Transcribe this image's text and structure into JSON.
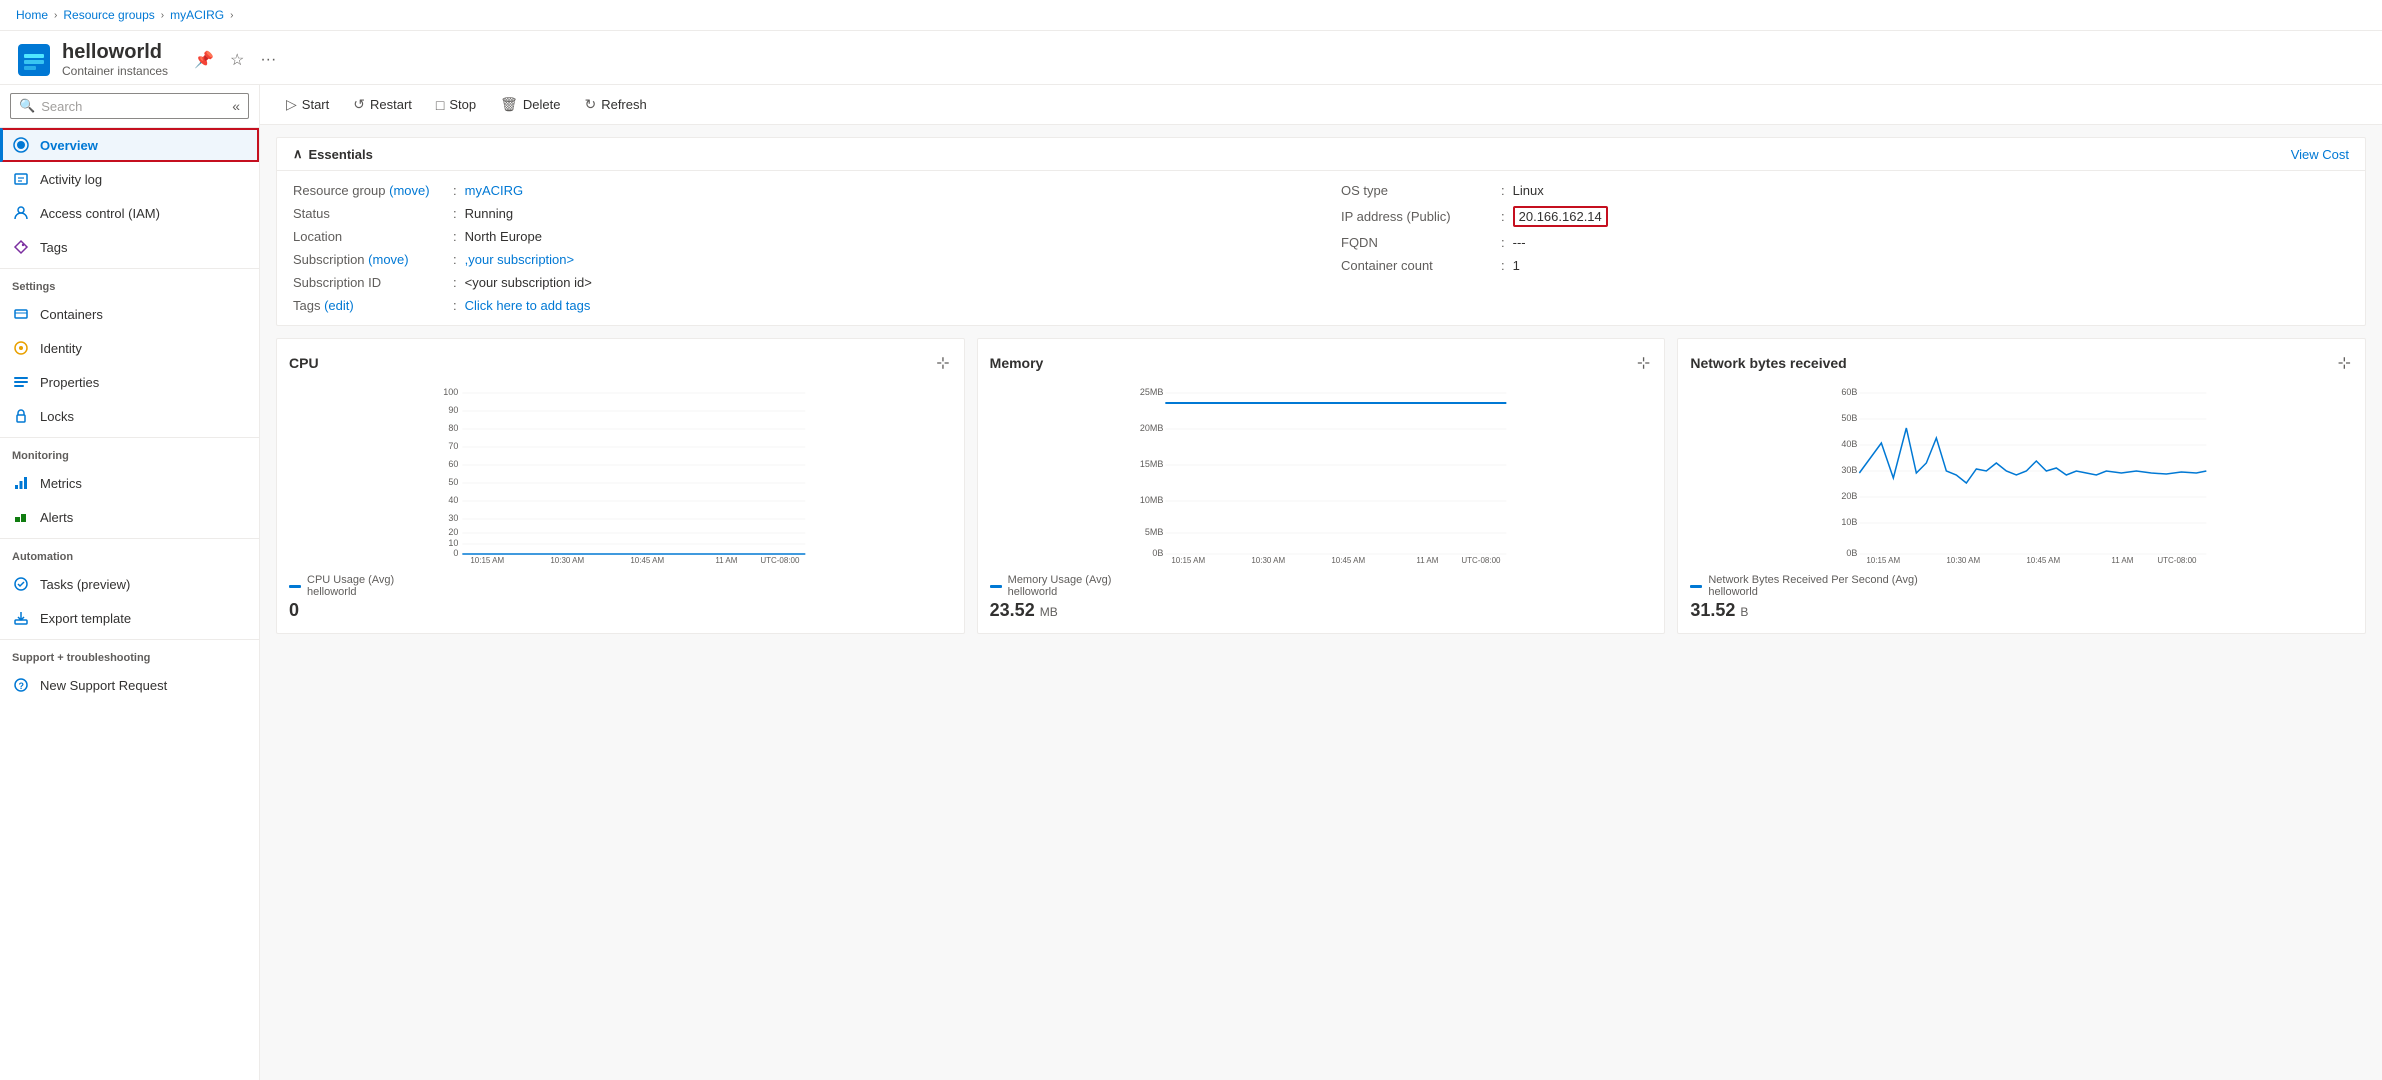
{
  "breadcrumb": {
    "items": [
      {
        "label": "Home",
        "link": true
      },
      {
        "label": "Resource groups",
        "link": true
      },
      {
        "label": "myACIRG",
        "link": true
      }
    ]
  },
  "resource": {
    "name": "helloworld",
    "type": "Container instances",
    "icon": "container"
  },
  "header_actions": {
    "pin_label": "📌",
    "star_label": "☆",
    "more_label": "..."
  },
  "toolbar": {
    "start_label": "Start",
    "restart_label": "Restart",
    "stop_label": "Stop",
    "delete_label": "Delete",
    "refresh_label": "Refresh"
  },
  "sidebar": {
    "search_placeholder": "Search",
    "sections": [
      {
        "items": [
          {
            "id": "overview",
            "label": "Overview",
            "active": true,
            "icon": "overview"
          }
        ]
      },
      {
        "items": [
          {
            "id": "activity-log",
            "label": "Activity log",
            "active": false,
            "icon": "activity"
          },
          {
            "id": "access-control",
            "label": "Access control (IAM)",
            "active": false,
            "icon": "iam"
          },
          {
            "id": "tags",
            "label": "Tags",
            "active": false,
            "icon": "tags"
          }
        ]
      },
      {
        "header": "Settings",
        "items": [
          {
            "id": "containers",
            "label": "Containers",
            "active": false,
            "icon": "containers"
          },
          {
            "id": "identity",
            "label": "Identity",
            "active": false,
            "icon": "identity"
          },
          {
            "id": "properties",
            "label": "Properties",
            "active": false,
            "icon": "properties"
          },
          {
            "id": "locks",
            "label": "Locks",
            "active": false,
            "icon": "locks"
          }
        ]
      },
      {
        "header": "Monitoring",
        "items": [
          {
            "id": "metrics",
            "label": "Metrics",
            "active": false,
            "icon": "metrics"
          },
          {
            "id": "alerts",
            "label": "Alerts",
            "active": false,
            "icon": "alerts"
          }
        ]
      },
      {
        "header": "Automation",
        "items": [
          {
            "id": "tasks",
            "label": "Tasks (preview)",
            "active": false,
            "icon": "tasks"
          },
          {
            "id": "export-template",
            "label": "Export template",
            "active": false,
            "icon": "export"
          }
        ]
      },
      {
        "header": "Support + troubleshooting",
        "items": [
          {
            "id": "new-support",
            "label": "New Support Request",
            "active": false,
            "icon": "support"
          }
        ]
      }
    ]
  },
  "essentials": {
    "title": "Essentials",
    "view_cost_label": "View Cost",
    "left_fields": [
      {
        "key": "Resource group (move)",
        "colon": ":",
        "value": "myACIRG",
        "link": true
      },
      {
        "key": "Status",
        "colon": ":",
        "value": "Running",
        "link": false
      },
      {
        "key": "Location",
        "colon": ":",
        "value": "North Europe",
        "link": false
      },
      {
        "key": "Subscription (move)",
        "colon": ":",
        "value": ",your subscription>",
        "link": true
      },
      {
        "key": "Subscription ID",
        "colon": ":",
        "value": "<your subscription id>",
        "link": false
      },
      {
        "key": "Tags (edit)",
        "colon": ":",
        "value": "Click here to add tags",
        "link": true
      }
    ],
    "right_fields": [
      {
        "key": "OS type",
        "colon": ":",
        "value": "Linux",
        "link": false
      },
      {
        "key": "IP address (Public)",
        "colon": ":",
        "value": "20.166.162.14",
        "link": false,
        "highlight": true
      },
      {
        "key": "FQDN",
        "colon": ":",
        "value": "---",
        "link": false
      },
      {
        "key": "Container count",
        "colon": ":",
        "value": "1",
        "link": false
      }
    ]
  },
  "charts": [
    {
      "id": "cpu",
      "title": "CPU",
      "legend_label": "CPU Usage (Avg)",
      "legend_sub": "helloworld",
      "value": "0",
      "value_unit": "",
      "color": "#0078d4",
      "x_labels": [
        "10:15 AM",
        "10:30 AM",
        "10:45 AM",
        "11 AM",
        "UTC-08:00"
      ],
      "y_labels": [
        "100",
        "90",
        "80",
        "70",
        "60",
        "50",
        "40",
        "30",
        "20",
        "10",
        "0"
      ],
      "type": "flat"
    },
    {
      "id": "memory",
      "title": "Memory",
      "legend_label": "Memory Usage (Avg)",
      "legend_sub": "helloworld",
      "value": "23.52",
      "value_unit": "MB",
      "color": "#0078d4",
      "x_labels": [
        "10:15 AM",
        "10:30 AM",
        "10:45 AM",
        "11 AM",
        "UTC-08:00"
      ],
      "y_labels": [
        "25MB",
        "20MB",
        "15MB",
        "10MB",
        "5MB",
        "0B"
      ],
      "type": "flat_high"
    },
    {
      "id": "network",
      "title": "Network bytes received",
      "legend_label": "Network Bytes Received Per Second (Avg)",
      "legend_sub": "helloworld",
      "value": "31.52",
      "value_unit": "B",
      "color": "#0078d4",
      "x_labels": [
        "10:15 AM",
        "10:30 AM",
        "10:45 AM",
        "11 AM",
        "UTC-08:00"
      ],
      "y_labels": [
        "60B",
        "50B",
        "40B",
        "30B",
        "20B",
        "10B",
        "0B"
      ],
      "type": "spiky"
    }
  ]
}
